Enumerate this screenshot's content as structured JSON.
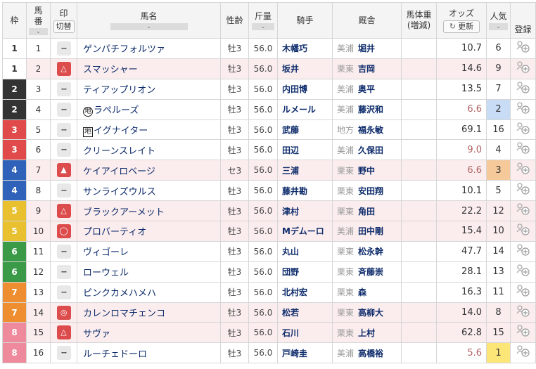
{
  "headers": {
    "waku": "枠",
    "umaban_line1": "馬",
    "umaban_line2": "番",
    "mark": "印",
    "mark_switch": "切替",
    "horse_name": "馬名",
    "sex_age": "性齢",
    "weight": "斤量",
    "jockey": "騎手",
    "trainer": "厩舎",
    "body_weight_line1": "馬体重",
    "body_weight_line2": "(増減)",
    "odds": "オッズ",
    "odds_refresh": "更新",
    "popularity_line1": "人気",
    "register": "登録",
    "sort_glyph": "⌄"
  },
  "waku_colors": {
    "1": {
      "bg": "#ffffff",
      "fg": "#333333"
    },
    "2": {
      "bg": "#333333",
      "fg": "#ffffff"
    },
    "3": {
      "bg": "#e04a4a",
      "fg": "#ffffff"
    },
    "4": {
      "bg": "#2f62b8",
      "fg": "#ffffff"
    },
    "5": {
      "bg": "#e8c030",
      "fg": "#ffffff"
    },
    "6": {
      "bg": "#3a9a48",
      "fg": "#ffffff"
    },
    "7": {
      "bg": "#ee8e30",
      "fg": "#ffffff"
    },
    "8": {
      "bg": "#ee8a9c",
      "fg": "#ffffff"
    }
  },
  "mark_icons": {
    "none": "--",
    "triangle-outline": "△",
    "triangle-filled": "▲",
    "circle": "◯",
    "double-circle": "◎"
  },
  "register_icon": "person-add-icon",
  "rows": [
    {
      "waku": "1",
      "num": "1",
      "mark": "none",
      "prefix": "",
      "name": "ゲンパチフォルツァ",
      "sex": "牡3",
      "weight": "56.0",
      "jockey": "木幡巧",
      "aff": "美浦",
      "trainer": "堀井",
      "body_weight": "",
      "odds": "10.7",
      "odds_low": false,
      "pop": "6"
    },
    {
      "waku": "1",
      "num": "2",
      "mark": "triangle-outline",
      "prefix": "",
      "name": "スマッシャー",
      "sex": "牡3",
      "weight": "56.0",
      "jockey": "坂井",
      "aff": "栗東",
      "trainer": "吉岡",
      "body_weight": "",
      "odds": "14.6",
      "odds_low": false,
      "pop": "9"
    },
    {
      "waku": "2",
      "num": "3",
      "mark": "none",
      "prefix": "",
      "name": "ティアップリオン",
      "sex": "牡3",
      "weight": "56.0",
      "jockey": "内田博",
      "aff": "美浦",
      "trainer": "奥平",
      "body_weight": "",
      "odds": "13.5",
      "odds_low": false,
      "pop": "7"
    },
    {
      "waku": "2",
      "num": "4",
      "mark": "none",
      "prefix": "circle",
      "name": "ラペルーズ",
      "sex": "牡3",
      "weight": "56.0",
      "jockey": "ルメール",
      "aff": "美浦",
      "trainer": "藤沢和",
      "body_weight": "",
      "odds": "6.6",
      "odds_low": true,
      "pop": "2"
    },
    {
      "waku": "3",
      "num": "5",
      "mark": "none",
      "prefix": "square",
      "name": "イグナイター",
      "sex": "牡3",
      "weight": "56.0",
      "jockey": "武藤",
      "aff": "地方",
      "trainer": "福永敏",
      "body_weight": "",
      "odds": "69.1",
      "odds_low": false,
      "pop": "16"
    },
    {
      "waku": "3",
      "num": "6",
      "mark": "none",
      "prefix": "",
      "name": "クリーンスレイト",
      "sex": "牡3",
      "weight": "56.0",
      "jockey": "田辺",
      "aff": "美浦",
      "trainer": "久保田",
      "body_weight": "",
      "odds": "9.0",
      "odds_low": true,
      "pop": "4"
    },
    {
      "waku": "4",
      "num": "7",
      "mark": "triangle-filled",
      "prefix": "",
      "name": "ケイアイロベージ",
      "sex": "セ3",
      "weight": "56.0",
      "jockey": "三浦",
      "aff": "栗東",
      "trainer": "野中",
      "body_weight": "",
      "odds": "6.6",
      "odds_low": true,
      "pop": "3"
    },
    {
      "waku": "4",
      "num": "8",
      "mark": "none",
      "prefix": "",
      "name": "サンライズウルス",
      "sex": "牡3",
      "weight": "56.0",
      "jockey": "藤井勘",
      "aff": "栗東",
      "trainer": "安田翔",
      "body_weight": "",
      "odds": "10.1",
      "odds_low": false,
      "pop": "5"
    },
    {
      "waku": "5",
      "num": "9",
      "mark": "triangle-outline",
      "prefix": "",
      "name": "ブラックアーメット",
      "sex": "牡3",
      "weight": "56.0",
      "jockey": "津村",
      "aff": "栗東",
      "trainer": "角田",
      "body_weight": "",
      "odds": "22.2",
      "odds_low": false,
      "pop": "12"
    },
    {
      "waku": "5",
      "num": "10",
      "mark": "circle",
      "prefix": "",
      "name": "プロバーティオ",
      "sex": "牡3",
      "weight": "56.0",
      "jockey": "Mデムーロ",
      "aff": "美浦",
      "trainer": "田中剛",
      "body_weight": "",
      "odds": "15.4",
      "odds_low": false,
      "pop": "10"
    },
    {
      "waku": "6",
      "num": "11",
      "mark": "none",
      "prefix": "",
      "name": "ヴィゴーレ",
      "sex": "牡3",
      "weight": "56.0",
      "jockey": "丸山",
      "aff": "栗東",
      "trainer": "松永幹",
      "body_weight": "",
      "odds": "47.7",
      "odds_low": false,
      "pop": "14"
    },
    {
      "waku": "6",
      "num": "12",
      "mark": "none",
      "prefix": "",
      "name": "ローウェル",
      "sex": "牡3",
      "weight": "56.0",
      "jockey": "団野",
      "aff": "栗東",
      "trainer": "斉藤崇",
      "body_weight": "",
      "odds": "28.1",
      "odds_low": false,
      "pop": "13"
    },
    {
      "waku": "7",
      "num": "13",
      "mark": "none",
      "prefix": "",
      "name": "ピンクカメハメハ",
      "sex": "牡3",
      "weight": "56.0",
      "jockey": "北村宏",
      "aff": "栗東",
      "trainer": "森",
      "body_weight": "",
      "odds": "16.3",
      "odds_low": false,
      "pop": "11"
    },
    {
      "waku": "7",
      "num": "14",
      "mark": "double-circle",
      "prefix": "",
      "name": "カレンロマチェンコ",
      "sex": "牡3",
      "weight": "56.0",
      "jockey": "松若",
      "aff": "栗東",
      "trainer": "高柳大",
      "body_weight": "",
      "odds": "14.0",
      "odds_low": false,
      "pop": "8"
    },
    {
      "waku": "8",
      "num": "15",
      "mark": "triangle-outline",
      "prefix": "",
      "name": "サヴァ",
      "sex": "牡3",
      "weight": "56.0",
      "jockey": "石川",
      "aff": "栗東",
      "trainer": "上村",
      "body_weight": "",
      "odds": "62.8",
      "odds_low": false,
      "pop": "15"
    },
    {
      "waku": "8",
      "num": "16",
      "mark": "none",
      "prefix": "",
      "name": "ルーチェドーロ",
      "sex": "牡3",
      "weight": "56.0",
      "jockey": "戸崎圭",
      "aff": "美浦",
      "trainer": "高橋裕",
      "body_weight": "",
      "odds": "5.6",
      "odds_low": true,
      "pop": "1"
    }
  ],
  "prefix_glyph": "地"
}
